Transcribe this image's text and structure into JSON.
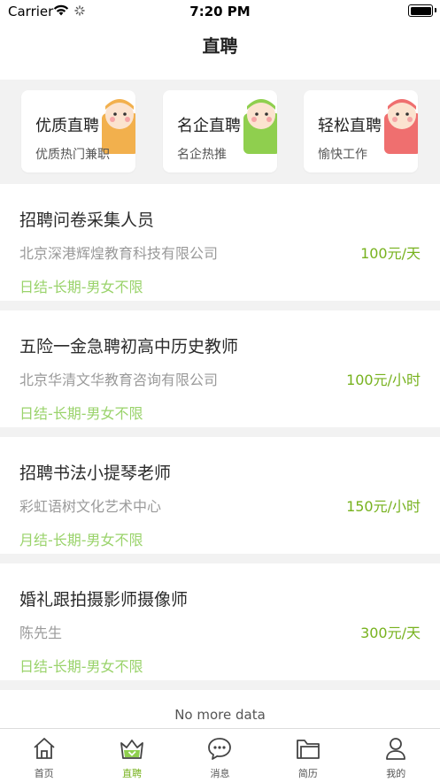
{
  "status_bar": {
    "carrier": "Carrier",
    "time": "7:20 PM"
  },
  "nav": {
    "title": "直聘"
  },
  "categories": [
    {
      "title": "优质直聘",
      "subtitle": "优质热门兼职",
      "mascot_color": "#f2b04d"
    },
    {
      "title": "名企直聘",
      "subtitle": "名企热推",
      "mascot_color": "#8fcf4e"
    },
    {
      "title": "轻松直聘",
      "subtitle": "愉快工作",
      "mascot_color": "#ef6f6f"
    }
  ],
  "jobs": [
    {
      "title": "招聘问卷采集人员",
      "company": "北京深港辉煌教育科技有限公司",
      "salary": "100元/天",
      "tags": "日结-长期-男女不限"
    },
    {
      "title": "五险一金急聘初高中历史教师",
      "company": "北京华清文华教育咨询有限公司",
      "salary": "100元/小时",
      "tags": "日结-长期-男女不限"
    },
    {
      "title": "招聘书法小提琴老师",
      "company": "彩虹语树文化艺术中心",
      "salary": "150元/小时",
      "tags": "月结-长期-男女不限"
    },
    {
      "title": "婚礼跟拍摄影师摄像师",
      "company": "陈先生",
      "salary": "300元/天",
      "tags": "日结-长期-男女不限"
    }
  ],
  "list_footer": "No more data",
  "tabbar": {
    "items": [
      {
        "label": "首页",
        "icon": "home-icon"
      },
      {
        "label": "直聘",
        "icon": "crown-icon",
        "active": true
      },
      {
        "label": "消息",
        "icon": "message-icon"
      },
      {
        "label": "简历",
        "icon": "folder-icon"
      },
      {
        "label": "我的",
        "icon": "user-icon"
      }
    ]
  },
  "colors": {
    "accent": "#77b21e",
    "tag": "#9ad36b",
    "page_bg": "#f2f2f2"
  }
}
